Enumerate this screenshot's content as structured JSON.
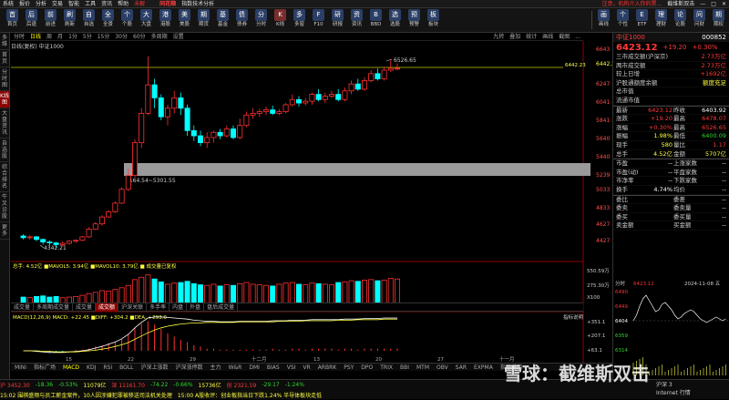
{
  "menubar": {
    "items": [
      "系统",
      "报价",
      "分析",
      "交易",
      "智能",
      "工具",
      "资讯",
      "帮助"
    ],
    "alert": "未解",
    "logo": "同花顺",
    "product": "指数技术分析",
    "right": [
      "注意，机构介入你的票...",
      "截维斯双击"
    ]
  },
  "toolbar": {
    "items": [
      {
        "label": "首页",
        "icon": "home-icon"
      },
      {
        "label": "后退",
        "icon": "back-icon"
      },
      {
        "label": "前进",
        "icon": "forward-icon"
      },
      {
        "label": "刷新",
        "icon": "refresh-icon"
      },
      {
        "label": "自选",
        "icon": "star-icon"
      },
      {
        "label": "全景",
        "icon": "panorama-icon"
      },
      {
        "label": "个股",
        "icon": "stock-icon"
      },
      {
        "label": "大盘",
        "icon": "index-icon"
      },
      {
        "label": "港股",
        "icon": "hk-icon"
      },
      {
        "label": "美股",
        "icon": "us-icon"
      },
      {
        "label": "期货",
        "icon": "futures-icon"
      },
      {
        "label": "基金",
        "icon": "fund-icon"
      },
      {
        "label": "债券",
        "icon": "bond-icon"
      },
      {
        "label": "分时",
        "icon": "timeshare-icon"
      },
      {
        "label": "K线",
        "icon": "kline-icon"
      },
      {
        "label": "多窗",
        "icon": "multi-window-icon"
      },
      {
        "label": "F10",
        "icon": "f10-icon"
      },
      {
        "label": "研报",
        "icon": "report-icon"
      },
      {
        "label": "资讯",
        "icon": "news-icon"
      },
      {
        "label": "BBD",
        "icon": "bbd-icon"
      },
      {
        "label": "选股",
        "icon": "select-icon"
      },
      {
        "label": "预警",
        "icon": "alert-icon"
      },
      {
        "label": "板块",
        "icon": "sector-icon"
      }
    ],
    "right_items": [
      {
        "label": "画线",
        "icon": "draw-icon"
      },
      {
        "label": "个性",
        "icon": "custom-icon"
      },
      {
        "label": "ETF",
        "icon": "etf-icon"
      },
      {
        "label": "理财",
        "icon": "wealth-icon"
      },
      {
        "label": "论股",
        "icon": "forum-icon"
      },
      {
        "label": "问财",
        "icon": "ask-icon"
      },
      {
        "label": "期权",
        "icon": "option-icon"
      }
    ]
  },
  "leftbar": [
    "多维",
    "首页",
    "分时图",
    "K线图",
    "大盘资讯",
    "自选股",
    "综合排名",
    "牛叉诊股",
    "更多"
  ],
  "periodbar": {
    "items": [
      "分时",
      "日线",
      "周",
      "月",
      "1分",
      "5分",
      "15分",
      "30分",
      "60分",
      "多周期",
      "设置"
    ],
    "active": 1,
    "right": [
      "九转",
      "叠加",
      "统计",
      "画线",
      "截图",
      "..."
    ]
  },
  "chartinfo": {
    "line1": "日线(复权)  中证1000"
  },
  "chart": {
    "price_labels": [
      "6643",
      "6442.23",
      "6247",
      "6041",
      "5841",
      "5640",
      "5440",
      "5239",
      "5033",
      "4833",
      "4627",
      "4427"
    ],
    "annotations": {
      "high": "6526.65",
      "low": "4342.21",
      "zone": "5164.54~5301.55"
    },
    "reference_line": "6442.23"
  },
  "volume": {
    "label": "总手: 4.52亿 ■MAVOL5: 3.94亿 ■MAVOL10: 3.79亿 ■ 成交量已复权",
    "axis": [
      "550.59万",
      "275.30万",
      "X100"
    ]
  },
  "subtabs": {
    "items": [
      "成交量",
      "多周期成交量",
      "成交量",
      "成交额",
      "沪深关联",
      "多手率",
      "内盘",
      "外盘",
      "盘后成交量"
    ],
    "active": 3
  },
  "macd": {
    "label": "MACD(12,26,9) MACD: +22.45 ■DIFF: +304.2 ■DEA: +293.0",
    "help": "指标说明",
    "axis": [
      "+351.1",
      "+207.1",
      "+63.1"
    ]
  },
  "dates": [
    "15",
    "22",
    "29",
    "十二月",
    "13",
    "20",
    "27",
    "十一月"
  ],
  "idxtabs": {
    "items": [
      "MiNi",
      "指标广场",
      "MACD",
      "KDJ",
      "RSI",
      "BOLL",
      "沪深上涨数",
      "沪深涨停数",
      "主力",
      "W&R",
      "DMI",
      "BIAS",
      "VSI",
      "VR",
      "ARBRK",
      "PSY",
      "DPO",
      "TRIX",
      "BBI",
      "MTM",
      "OBV",
      "SAR",
      "EXPMA",
      "指标说明"
    ],
    "active": 2
  },
  "quote": {
    "name": "中证1000",
    "code": "000852",
    "price": "6423.12",
    "change": "+19.20",
    "change_pct": "+0.30%",
    "rows1": [
      {
        "k": "三市成交额(沪深京)",
        "v": "2.73万亿",
        "c": "red"
      },
      {
        "k": "两市成交额",
        "v": "2.73万亿",
        "c": "red"
      },
      {
        "k": "较上日增",
        "v": "+1692亿",
        "c": "red"
      },
      {
        "k": "沪股通额度余额",
        "v": "额度充足",
        "c": "yel"
      },
      {
        "k": "总市值",
        "v": "",
        "c": "wht"
      },
      {
        "k": "流通市值",
        "v": "",
        "c": "wht"
      }
    ],
    "rows2": [
      {
        "k": "最新",
        "v": "6423.12",
        "k2": "昨收",
        "v2": "6403.92",
        "c": "red",
        "c2": "wht"
      },
      {
        "k": "涨跌",
        "v": "+19.20",
        "k2": "最高",
        "v2": "6478.07",
        "c": "red",
        "c2": "red"
      },
      {
        "k": "涨幅",
        "v": "+0.30%",
        "k2": "最高",
        "v2": "6526.65",
        "c": "red",
        "c2": "red"
      },
      {
        "k": "振幅",
        "v": "1.98%",
        "k2": "最低",
        "v2": "6400.09",
        "c": "yel",
        "c2": "grn"
      },
      {
        "k": "现手",
        "v": "580",
        "k2": "量比",
        "v2": "1.17",
        "c": "yel",
        "c2": "red"
      },
      {
        "k": "总手",
        "v": "4.52亿",
        "k2": "金额",
        "v2": "5707亿",
        "c": "yel",
        "c2": "yel"
      }
    ],
    "rows3": [
      {
        "k": "市盈",
        "v": "--",
        "k2": "上涨家数",
        "v2": "--"
      },
      {
        "k": "市盈(动)",
        "v": "--",
        "k2": "平盘家数",
        "v2": "--"
      },
      {
        "k": "市净率",
        "v": "--",
        "k2": "下跌家数",
        "v2": "--"
      },
      {
        "k": "换手",
        "v": "4.74%",
        "k2": "均价",
        "v2": "--"
      }
    ],
    "rows4": [
      {
        "k": "委比",
        "v": "",
        "k2": "委差",
        "v2": "--"
      },
      {
        "k": "委卖",
        "v": "",
        "k2": "委卖量",
        "v2": "--"
      },
      {
        "k": "委买",
        "v": "",
        "k2": "委买量",
        "v2": "--"
      },
      {
        "k": "卖金额",
        "v": "",
        "k2": "买金额",
        "v2": "--"
      }
    ],
    "mini": {
      "label": "分时",
      "price": "6423.12",
      "date": "2024-11-08 五",
      "axis": [
        "6490",
        "6449",
        "6404",
        "6359",
        "6314"
      ]
    }
  },
  "statusbar": {
    "row1": [
      {
        "t": "沪 3452.30",
        "c": "red"
      },
      {
        "t": "-18.36",
        "c": "grn"
      },
      {
        "t": "-0.53%",
        "c": "grn"
      },
      {
        "t": "11079亿",
        "c": "yel"
      },
      {
        "t": "深 11161.70",
        "c": "red"
      },
      {
        "t": "-74.22",
        "c": "grn"
      },
      {
        "t": "-0.66%",
        "c": "grn"
      },
      {
        "t": "15736亿",
        "c": "yel"
      },
      {
        "t": "创 2321.59",
        "c": "red"
      },
      {
        "t": "-29.17",
        "c": "grn"
      },
      {
        "t": "-1.24%",
        "c": "grn"
      }
    ],
    "row2": [
      {
        "t": "15:02 围棋盛频与员工薪金案件，10人因涉嫌犯罪被移送司法机关处理",
        "c": "yel"
      },
      {
        "t": "15:00 A股收评：创业板指当日下跌1.24% 半导体板块走低",
        "c": "yel"
      }
    ],
    "right": [
      "沪深 3",
      "Internet 行情"
    ],
    "brand": "雪球：截维斯双击"
  }
}
